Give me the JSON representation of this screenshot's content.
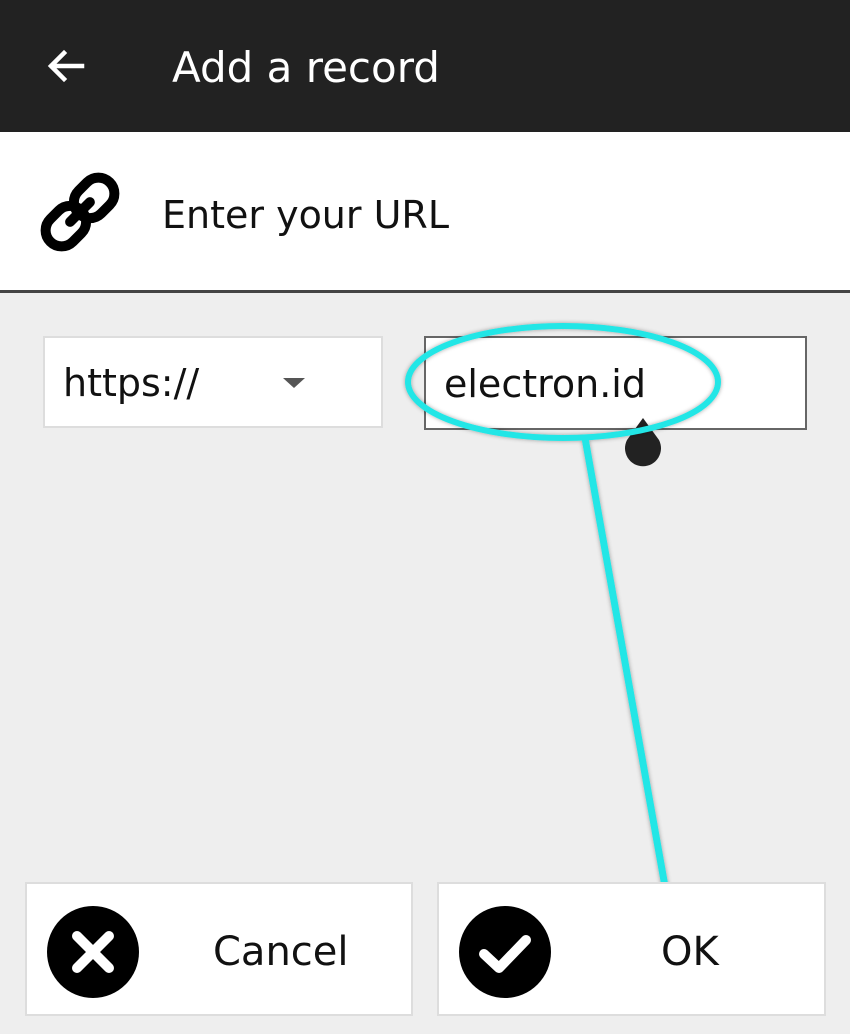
{
  "app_bar": {
    "title": "Add a record",
    "back_icon": "arrow-left-icon"
  },
  "header": {
    "icon": "link-icon",
    "title": "Enter your URL"
  },
  "form": {
    "scheme_select": {
      "value": "https://",
      "icon": "dropdown-arrow-icon"
    },
    "url_input": {
      "value": "electron.id"
    }
  },
  "actions": {
    "cancel": {
      "label": "Cancel",
      "icon": "close-circle-icon"
    },
    "ok": {
      "label": "OK",
      "icon": "check-circle-icon"
    }
  },
  "colors": {
    "app_bar": "#222222",
    "background": "#eeeeee",
    "annotation": "#22e6e6"
  }
}
